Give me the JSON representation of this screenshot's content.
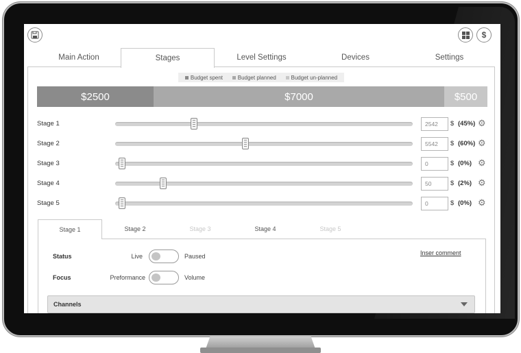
{
  "main_tabs": [
    {
      "label": "Main Action"
    },
    {
      "label": "Stages"
    },
    {
      "label": "Level Settings"
    },
    {
      "label": "Devices"
    },
    {
      "label": "Settings"
    }
  ],
  "active_main_tab": "Stages",
  "header_icons": {
    "save": "save-icon",
    "grid": "grid-icon",
    "dollar": "$"
  },
  "legend": [
    {
      "label": "Budget spent",
      "color": "#8b8b8b"
    },
    {
      "label": "Budget planned",
      "color": "#a9a9a9"
    },
    {
      "label": "Budget un-planned",
      "color": "#c7c7c7"
    }
  ],
  "budget": {
    "spent": "$2500",
    "planned": "$7000",
    "unplanned": "$500"
  },
  "stages": [
    {
      "label": "Stage 1",
      "value": "2542",
      "currency": "$",
      "percent": "(45%)",
      "slider": 0.265
    },
    {
      "label": "Stage 2",
      "value": "5542",
      "currency": "$",
      "percent": "(60%)",
      "slider": 0.437
    },
    {
      "label": "Stage 3",
      "value": "0",
      "currency": "$",
      "percent": "(0%)",
      "slider": 0.023
    },
    {
      "label": "Stage 4",
      "value": "50",
      "currency": "$",
      "percent": "(2%)",
      "slider": 0.162
    },
    {
      "label": "Stage 5",
      "value": "0",
      "currency": "$",
      "percent": "(0%)",
      "slider": 0.023
    }
  ],
  "stage_tabs": [
    {
      "label": "Stage 1",
      "state": "active"
    },
    {
      "label": "Stage 2",
      "state": "normal"
    },
    {
      "label": "Stage 3",
      "state": "disabled"
    },
    {
      "label": "Stage 4",
      "state": "normal"
    },
    {
      "label": "Stage 5",
      "state": "disabled"
    }
  ],
  "status": {
    "label": "Status",
    "left": "Live",
    "right": "Paused"
  },
  "focus": {
    "label": "Focus",
    "left": "Preformance",
    "right": "Volume"
  },
  "insert_comment": "Inser comment",
  "channels": {
    "label": "Channels"
  }
}
